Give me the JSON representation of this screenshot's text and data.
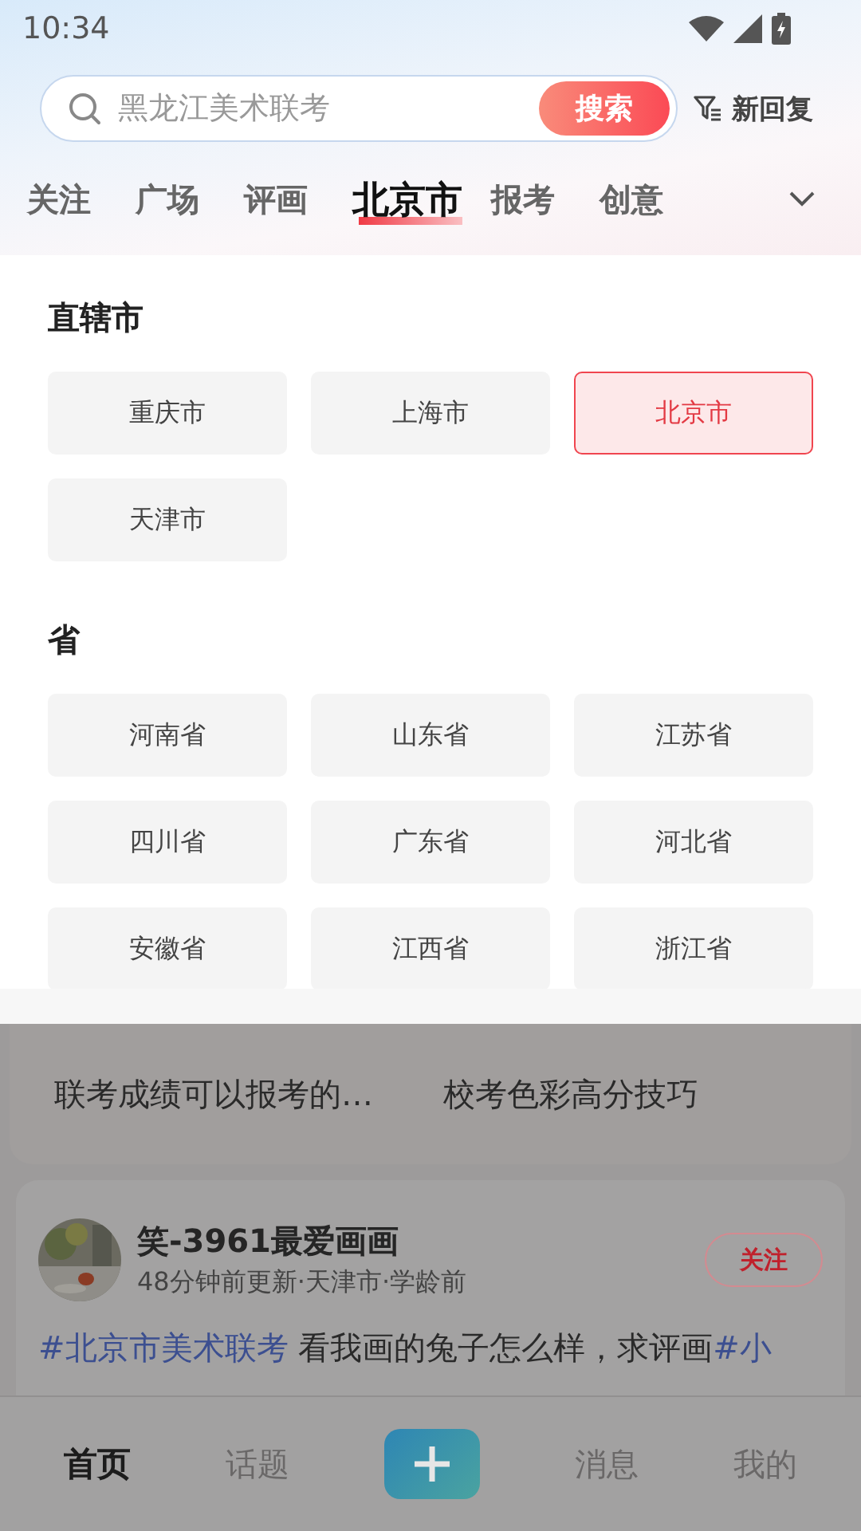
{
  "status_bar": {
    "time": "10:34"
  },
  "search": {
    "placeholder": "黑龙江美术联考",
    "button": "搜索",
    "filter": "新回复"
  },
  "tabs": [
    {
      "label": "关注",
      "selected": false
    },
    {
      "label": "广场",
      "selected": false
    },
    {
      "label": "评画",
      "selected": false
    },
    {
      "label": "北京市",
      "selected": true
    },
    {
      "label": "报考",
      "selected": false
    },
    {
      "label": "创意",
      "selected": false
    }
  ],
  "region_panel": [
    {
      "title": "直辖市",
      "items": [
        {
          "label": "重庆市",
          "selected": false
        },
        {
          "label": "上海市",
          "selected": false
        },
        {
          "label": "北京市",
          "selected": true
        },
        {
          "label": "天津市",
          "selected": false
        }
      ]
    },
    {
      "title": "省",
      "items": [
        {
          "label": "河南省",
          "selected": false
        },
        {
          "label": "山东省",
          "selected": false
        },
        {
          "label": "江苏省",
          "selected": false
        },
        {
          "label": "四川省",
          "selected": false
        },
        {
          "label": "广东省",
          "selected": false
        },
        {
          "label": "河北省",
          "selected": false
        },
        {
          "label": "安徽省",
          "selected": false
        },
        {
          "label": "江西省",
          "selected": false
        },
        {
          "label": "浙江省",
          "selected": false
        }
      ]
    }
  ],
  "topics": [
    "联考成绩可以报考的…",
    "校考色彩高分技巧"
  ],
  "post": {
    "author": "笑-3961最爱画画",
    "meta": "48分钟前更新·天津市·学龄前",
    "follow": "关注",
    "body": [
      {
        "kind": "tag",
        "text": "#北京市美术联考"
      },
      {
        "kind": "text",
        "text": " 看我画的兔子怎么样，求评画"
      },
      {
        "kind": "tag",
        "text": "#小"
      }
    ]
  },
  "bottom_nav": [
    {
      "kind": "tab",
      "label": "首页",
      "selected": true
    },
    {
      "kind": "tab",
      "label": "话题",
      "selected": false
    },
    {
      "kind": "add"
    },
    {
      "kind": "tab",
      "label": "消息",
      "selected": false
    },
    {
      "kind": "tab",
      "label": "我的",
      "selected": false
    }
  ]
}
